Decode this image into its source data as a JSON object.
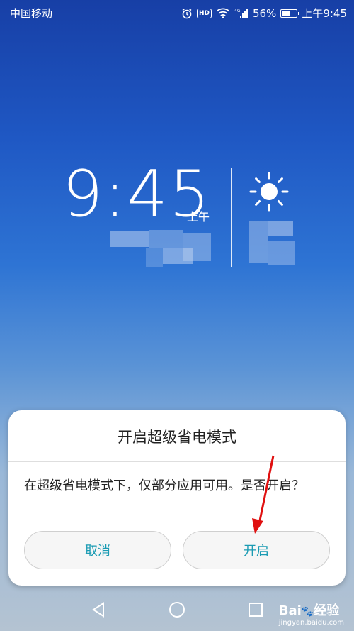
{
  "status_bar": {
    "carrier": "中国移动",
    "battery_percent": "56%",
    "time": "上午9:45",
    "battery_level": 0.56,
    "icons": [
      "alarm-icon",
      "hd-icon",
      "wifi-icon",
      "4g-signal-icon",
      "battery-icon"
    ]
  },
  "lockscreen": {
    "time": "9:45",
    "ampm": "上午",
    "weather_icon": "sun-icon"
  },
  "dialog": {
    "title": "开启超级省电模式",
    "message": "在超级省电模式下，仅部分应用可用。是否开启？",
    "cancel_label": "取消",
    "confirm_label": "开启",
    "button_text_color": "#1a9bb3"
  },
  "navbar": {
    "icons": [
      "back-icon",
      "home-icon",
      "recents-icon"
    ]
  },
  "watermark": {
    "brand": "Bai",
    "brand_suffix": "经验",
    "domain": "jingyan.baidu.com"
  },
  "annotation": {
    "arrow_color": "#e01010"
  }
}
